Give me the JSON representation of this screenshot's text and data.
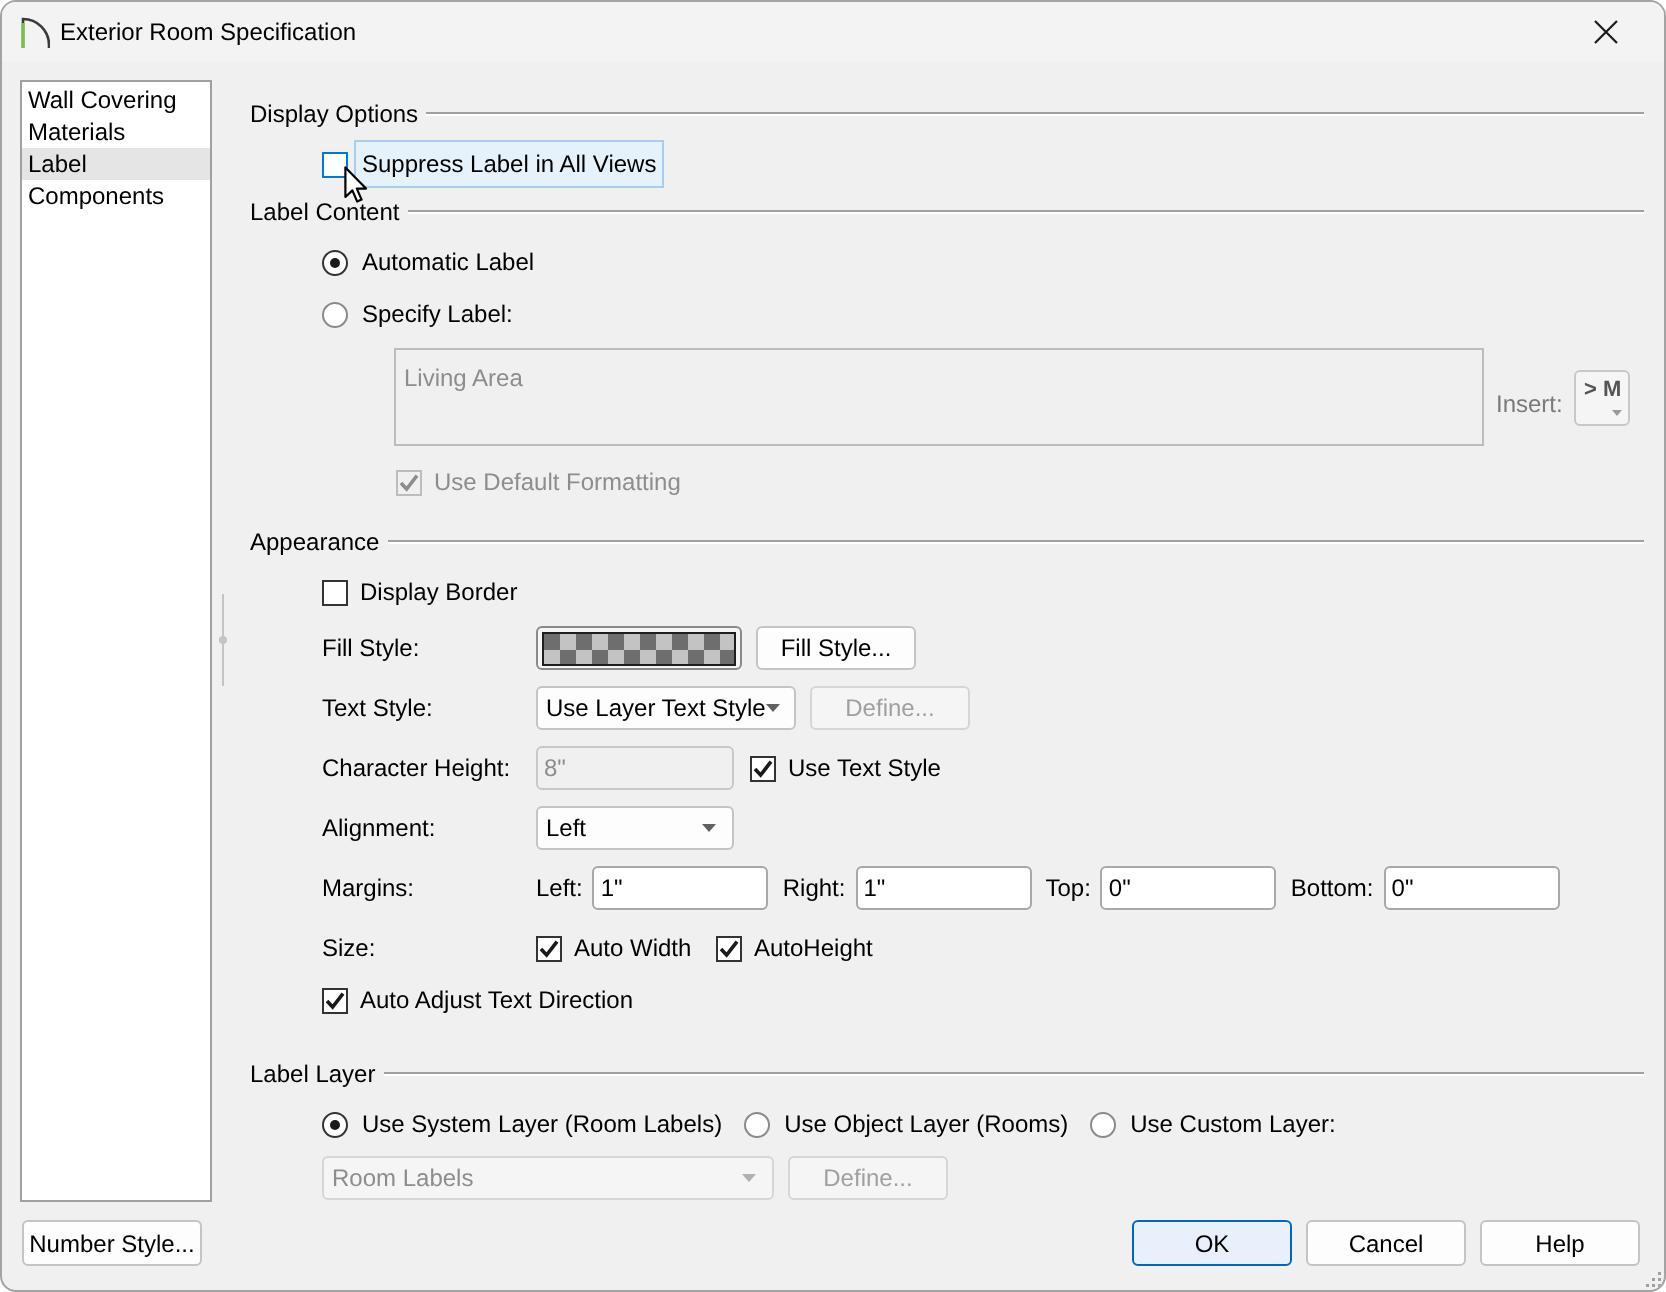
{
  "window": {
    "title": "Exterior Room Specification"
  },
  "sidebar": {
    "items": [
      {
        "label": "Wall Covering",
        "selected": false
      },
      {
        "label": "Materials",
        "selected": false
      },
      {
        "label": "Label",
        "selected": true
      },
      {
        "label": "Components",
        "selected": false
      }
    ],
    "button": "Number Style..."
  },
  "display_options": {
    "heading": "Display Options",
    "suppress_label": {
      "label": "Suppress Label in All Views",
      "checked": false,
      "hovered": true
    }
  },
  "label_content": {
    "heading": "Label Content",
    "options": [
      {
        "label": "Automatic Label",
        "selected": true
      },
      {
        "label": "Specify Label:",
        "selected": false
      }
    ],
    "label_text": {
      "value": "Living Area",
      "disabled": true
    },
    "insert": {
      "label": "Insert:",
      "button": "> M",
      "disabled": true
    },
    "use_default_formatting": {
      "label": "Use Default Formatting",
      "checked": true,
      "disabled": true
    }
  },
  "appearance": {
    "heading": "Appearance",
    "display_border": {
      "label": "Display Border",
      "checked": false
    },
    "fill_style": {
      "label": "Fill Style:",
      "button": "Fill Style..."
    },
    "text_style": {
      "label": "Text Style:",
      "value": "Use Layer Text Style",
      "define_button": {
        "label": "Define...",
        "disabled": true
      }
    },
    "character_height": {
      "label": "Character Height:",
      "value": "8\"",
      "disabled": true
    },
    "use_text_style": {
      "label": "Use Text Style",
      "checked": true
    },
    "alignment": {
      "label": "Alignment:",
      "value": "Left"
    },
    "margins": {
      "label": "Margins:",
      "fields": [
        {
          "label": "Left:",
          "value": "1\""
        },
        {
          "label": "Right:",
          "value": "1\""
        },
        {
          "label": "Top:",
          "value": "0\""
        },
        {
          "label": "Bottom:",
          "value": "0\""
        }
      ]
    },
    "size": {
      "label": "Size:",
      "options": [
        {
          "label": "Auto Width",
          "checked": true
        },
        {
          "label": "AutoHeight",
          "checked": true
        }
      ]
    },
    "auto_adjust_text_direction": {
      "label": "Auto Adjust Text Direction",
      "checked": true
    }
  },
  "label_layer": {
    "heading": "Label Layer",
    "options": [
      {
        "label": "Use System Layer (Room Labels)",
        "selected": true
      },
      {
        "label": "Use Object Layer (Rooms)",
        "selected": false
      },
      {
        "label": "Use Custom Layer:",
        "selected": false
      }
    ],
    "layer": {
      "value": "Room Labels",
      "disabled": true
    },
    "define_button": {
      "label": "Define...",
      "disabled": true
    }
  },
  "buttons": [
    {
      "label": "OK",
      "default": true
    },
    {
      "label": "Cancel",
      "default": false
    },
    {
      "label": "Help",
      "default": false
    }
  ]
}
